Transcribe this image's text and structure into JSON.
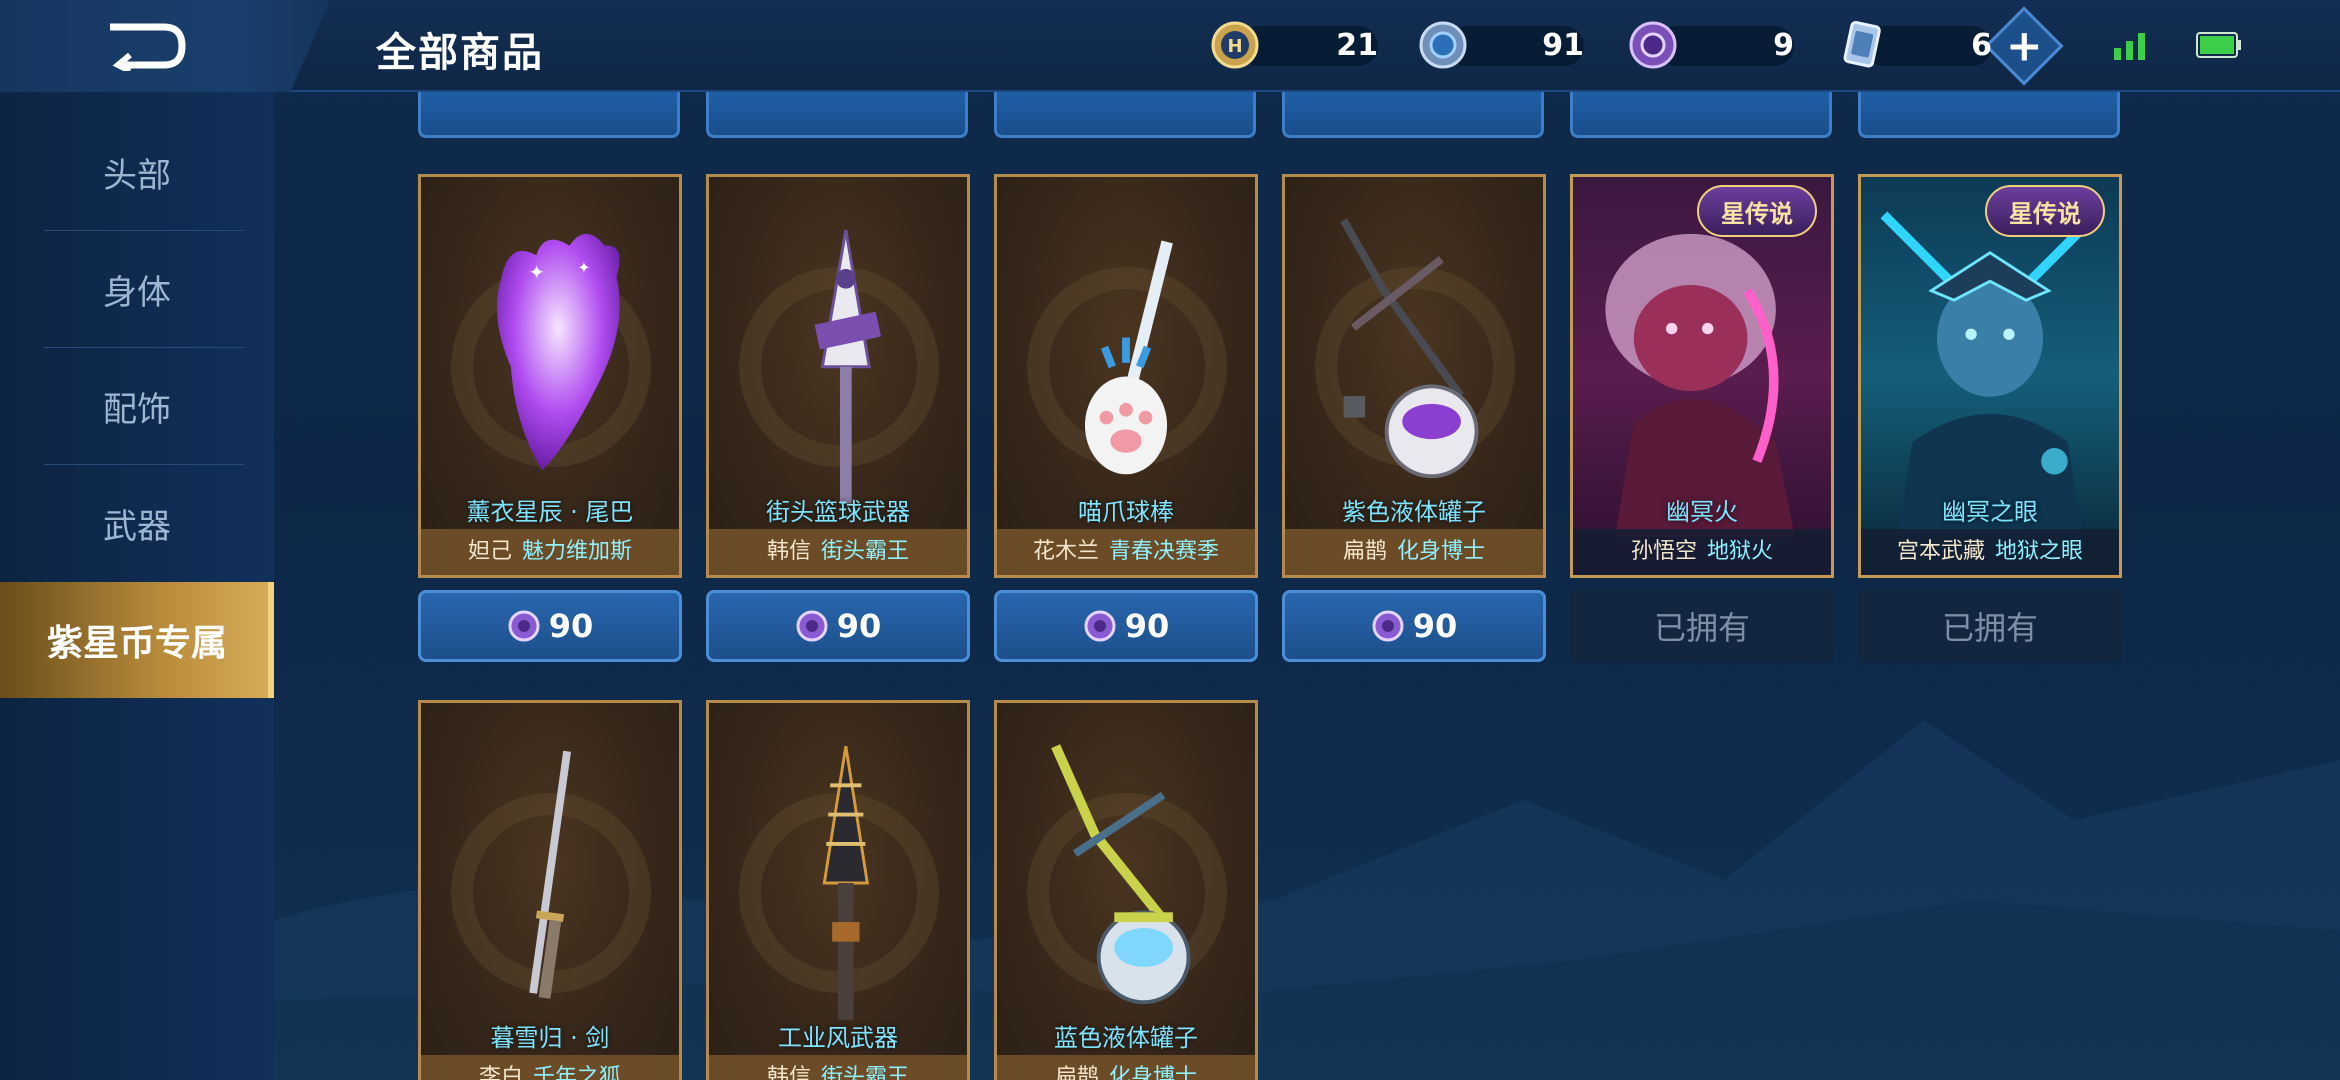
{
  "header": {
    "title": "全部商品",
    "currencies": [
      {
        "icon": "gold-token-icon",
        "value": "21"
      },
      {
        "icon": "blue-coin-icon",
        "value": "91"
      },
      {
        "icon": "purple-star-coin-icon",
        "value": "9"
      },
      {
        "icon": "card-ticket-icon",
        "value": "6"
      }
    ],
    "add_label": "+"
  },
  "sidebar": {
    "items": [
      {
        "label": "头部"
      },
      {
        "label": "身体"
      },
      {
        "label": "配饰"
      },
      {
        "label": "武器"
      },
      {
        "label": "紫星币专属"
      }
    ],
    "active_index": 4
  },
  "products": [
    {
      "name": "薰衣星辰 · 尾巴",
      "hero": "妲己",
      "skin": "魅力维加斯",
      "price": "90"
    },
    {
      "name": "街头篮球武器",
      "hero": "韩信",
      "skin": "街头霸王",
      "price": "90"
    },
    {
      "name": "喵爪球棒",
      "hero": "花木兰",
      "skin": "青春决赛季",
      "price": "90"
    },
    {
      "name": "紫色液体罐子",
      "hero": "扁鹊",
      "skin": "化身博士",
      "price": "90"
    },
    {
      "name": "幽冥火",
      "hero": "孙悟空",
      "skin": "地狱火",
      "badge": "星传说",
      "status": "已拥有"
    },
    {
      "name": "幽冥之眼",
      "hero": "宫本武藏",
      "skin": "地狱之眼",
      "badge": "星传说",
      "status": "已拥有"
    },
    {
      "name": "暮雪归 · 剑",
      "hero": "李白",
      "skin": "千年之狐"
    },
    {
      "name": "工业风武器",
      "hero": "韩信",
      "skin": "街头霸王"
    },
    {
      "name": "蓝色液体罐子",
      "hero": "扁鹊",
      "skin": "化身博士"
    }
  ],
  "colors": {
    "accent_gold": "#d7ad5a",
    "name_cyan": "#7ee3ff",
    "price_blue": "#2866ad"
  }
}
